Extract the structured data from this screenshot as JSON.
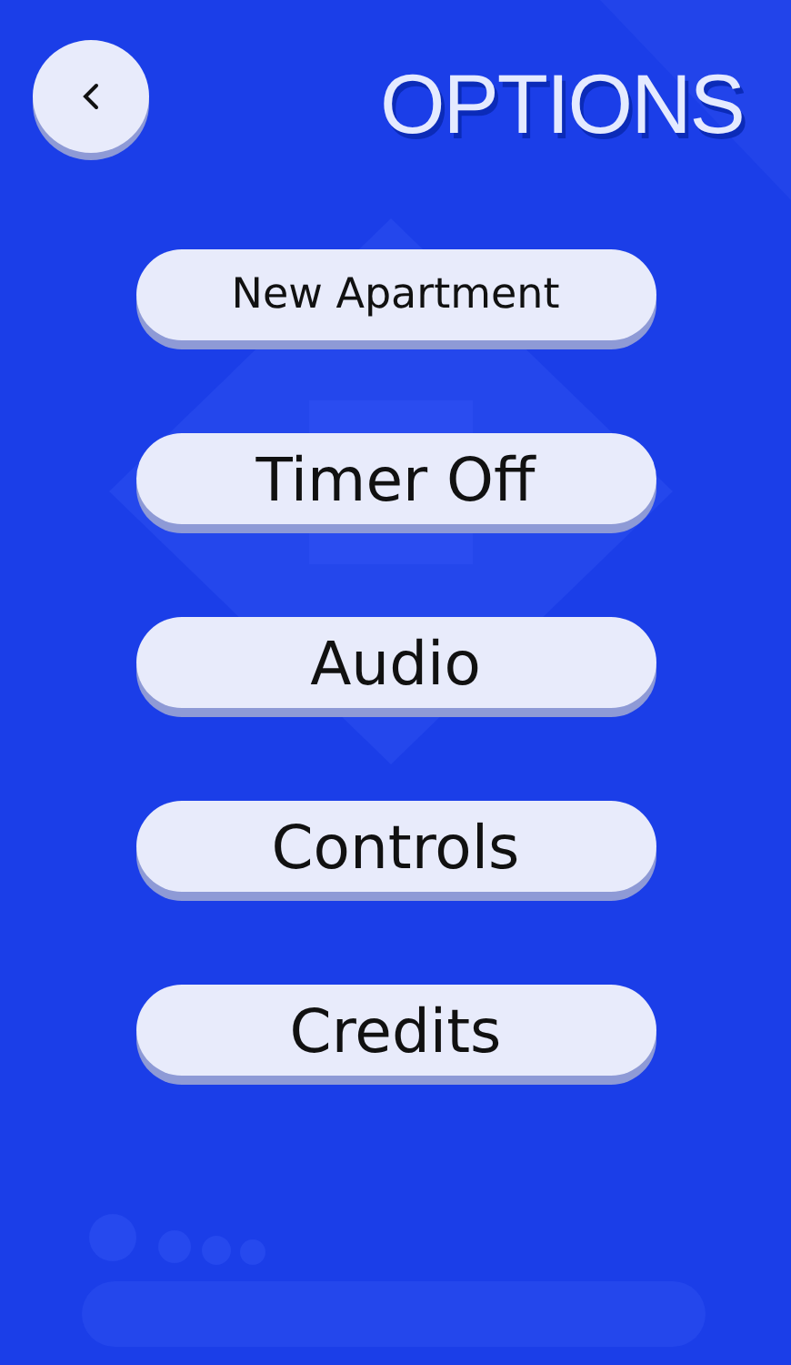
{
  "title": "OPTIONS",
  "menu": [
    {
      "label": "New Apartment"
    },
    {
      "label": "Timer Off"
    },
    {
      "label": "Audio"
    },
    {
      "label": "Controls"
    },
    {
      "label": "Credits"
    }
  ]
}
